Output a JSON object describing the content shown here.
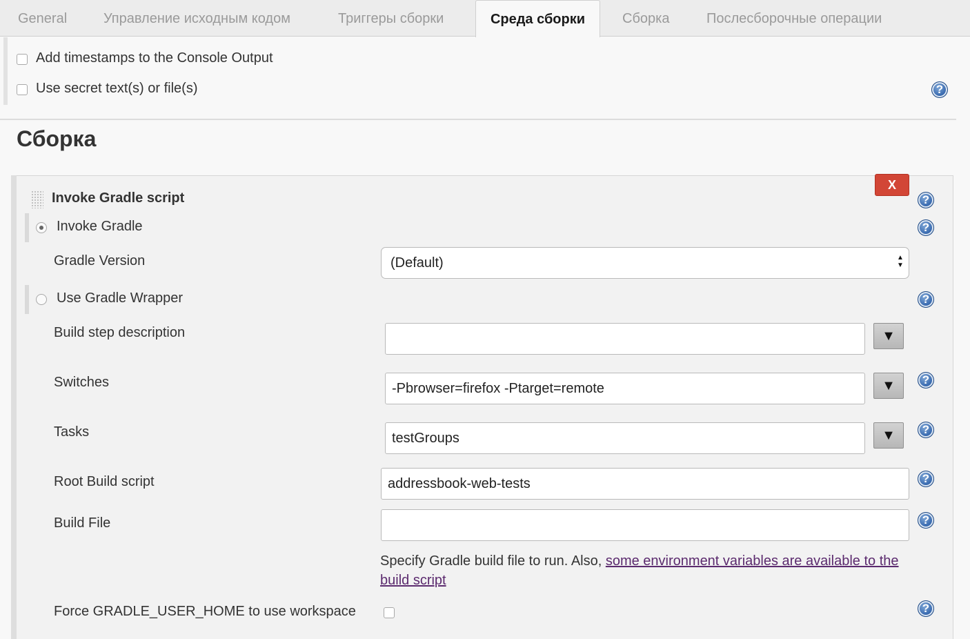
{
  "tabs": [
    {
      "label": "General"
    },
    {
      "label": "Управление исходным кодом"
    },
    {
      "label": "Триггеры сборки"
    },
    {
      "label": "Среда сборки"
    },
    {
      "label": "Сборка"
    },
    {
      "label": "Послесборочные операции"
    }
  ],
  "active_tab": "Среда сборки",
  "build_environment": {
    "timestamps_label": "Add timestamps to the Console Output",
    "secret_label": "Use secret text(s) or file(s)"
  },
  "build_section": {
    "title": "Сборка"
  },
  "step": {
    "title": "Invoke Gradle script",
    "delete_label": "X",
    "invoke_gradle_label": "Invoke Gradle",
    "gradle_version_label": "Gradle Version",
    "gradle_version_value": "(Default)",
    "wrapper_label": "Use Gradle Wrapper",
    "description_label": "Build step description",
    "description_value": "",
    "switches_label": "Switches",
    "switches_value": "-Pbrowser=firefox -Ptarget=remote",
    "tasks_label": "Tasks",
    "tasks_value": "testGroups",
    "root_script_label": "Root Build script",
    "root_script_value": "addressbook-web-tests",
    "build_file_label": "Build File",
    "build_file_value": "",
    "hint_text": "Specify Gradle build file to run. Also, ",
    "hint_link": "some environment variables are available to the build script",
    "force_home_label": "Force GRADLE_USER_HOME to use workspace",
    "expand_glyph": "▼",
    "help_glyph": "?"
  }
}
